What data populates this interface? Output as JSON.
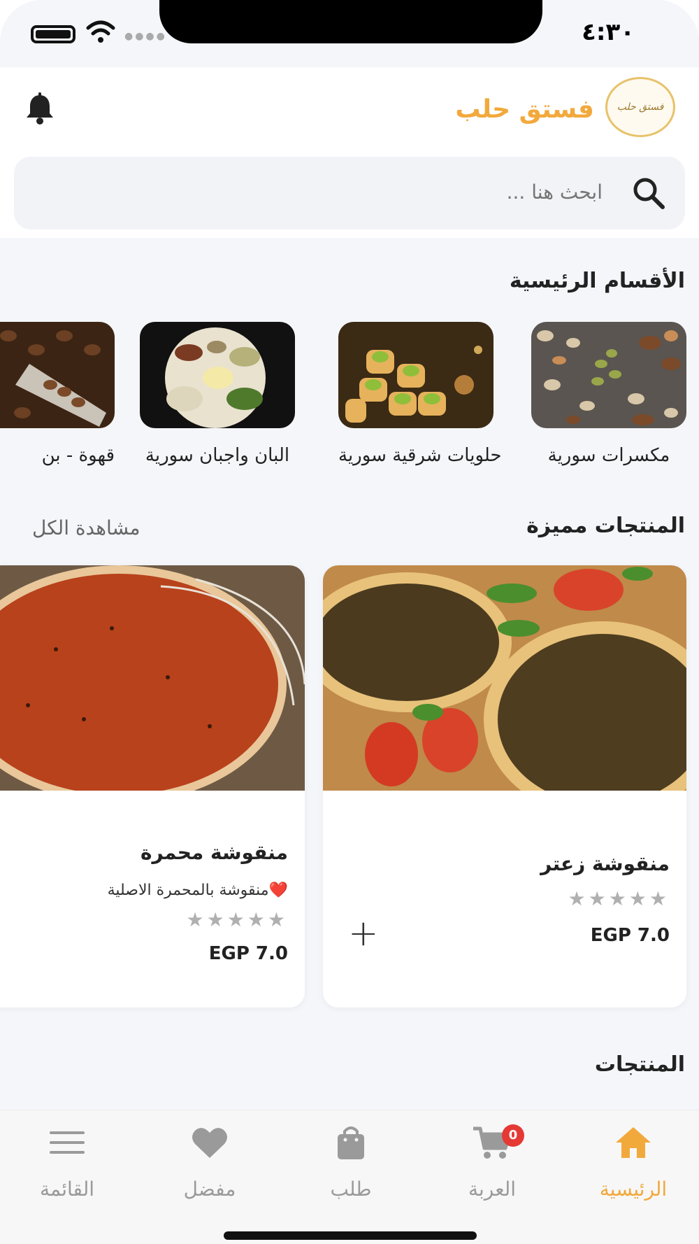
{
  "status_bar": {
    "time": "٤:٣٠"
  },
  "header": {
    "brand": "فستق حلب",
    "logo_text": "فستق حلب"
  },
  "search": {
    "placeholder": "ابحث هنا ..."
  },
  "categories": {
    "title": "الأقسام الرئيسية",
    "items": [
      {
        "label": "مكسرات سورية"
      },
      {
        "label": "حلويات شرقية سورية"
      },
      {
        "label": "البان واجبان سورية"
      },
      {
        "label": "قهوة - بن"
      }
    ]
  },
  "featured": {
    "title": "المنتجات مميزة",
    "see_all": "مشاهدة الكل",
    "products": [
      {
        "name": "منقوشة زعتر",
        "description": "",
        "price": "EGP 7.0",
        "add": "+"
      },
      {
        "name": "منقوشة محمرة",
        "description": "منقوشة بالمحمرة الاصلية❤️",
        "price": "EGP 7.0"
      }
    ],
    "stars": "★★★★★"
  },
  "products": {
    "title": "المنتجات"
  },
  "nav": {
    "items": [
      {
        "label": "الرئيسية",
        "icon": "home-icon"
      },
      {
        "label": "العربة",
        "icon": "cart-icon",
        "badge": "0"
      },
      {
        "label": "طلب",
        "icon": "bag-icon"
      },
      {
        "label": "مفضل",
        "icon": "heart-icon"
      },
      {
        "label": "القائمة",
        "icon": "menu-icon"
      }
    ]
  },
  "colors": {
    "accent": "#f2a93c",
    "badge": "#e53935",
    "background": "#f4f6fa"
  }
}
